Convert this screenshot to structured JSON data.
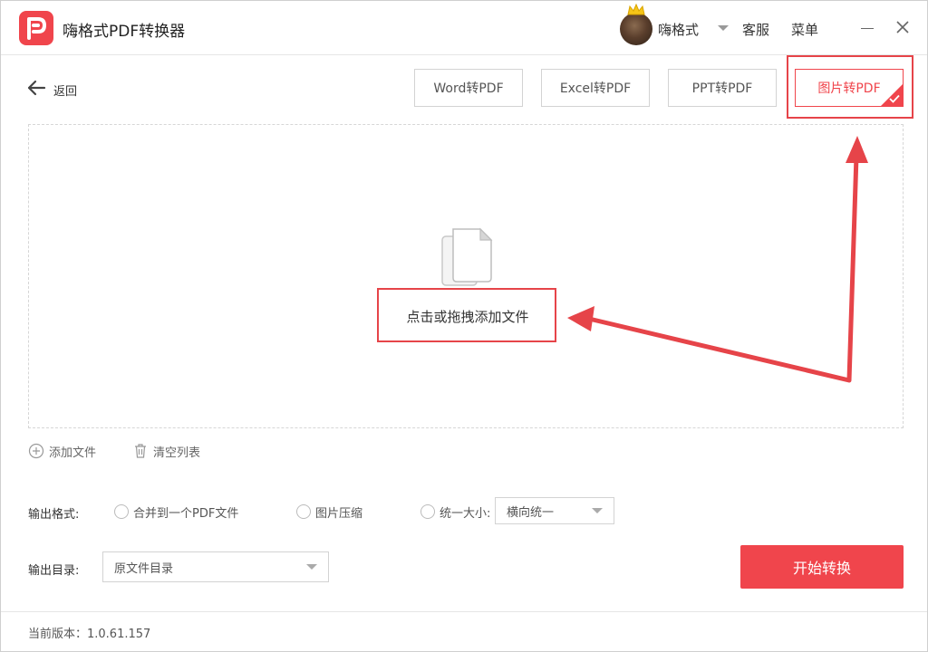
{
  "app": {
    "title": "嗨格式PDF转换器"
  },
  "header": {
    "user_name": "嗨格式",
    "service_label": "客服",
    "menu_label": "菜单"
  },
  "nav": {
    "back_label": "返回"
  },
  "tabs": [
    {
      "label": "Word转PDF",
      "active": false
    },
    {
      "label": "Excel转PDF",
      "active": false
    },
    {
      "label": "PPT转PDF",
      "active": false
    },
    {
      "label": "图片转PDF",
      "active": true
    }
  ],
  "dropzone": {
    "hint": "点击或拖拽添加文件"
  },
  "list_actions": {
    "add_label": "添加文件",
    "clear_label": "清空列表"
  },
  "output_format": {
    "label": "输出格式:",
    "options": [
      {
        "label": "合并到一个PDF文件",
        "checked": false
      },
      {
        "label": "图片压缩",
        "checked": false
      },
      {
        "label": "统一大小:",
        "checked": false
      }
    ],
    "size_select_value": "横向统一"
  },
  "output_dir": {
    "label": "输出目录:",
    "select_value": "原文件目录"
  },
  "start_button": {
    "label": "开始转换"
  },
  "footer": {
    "version": "当前版本：1.0.61.157"
  },
  "colors": {
    "accent": "#f0454c",
    "annotation": "#e64449"
  },
  "icons": [
    "app-logo-icon",
    "crown-icon",
    "minimize-icon",
    "close-icon",
    "back-arrow-icon",
    "checkmark-icon",
    "file-stack-icon",
    "add-circle-icon",
    "trash-icon"
  ]
}
